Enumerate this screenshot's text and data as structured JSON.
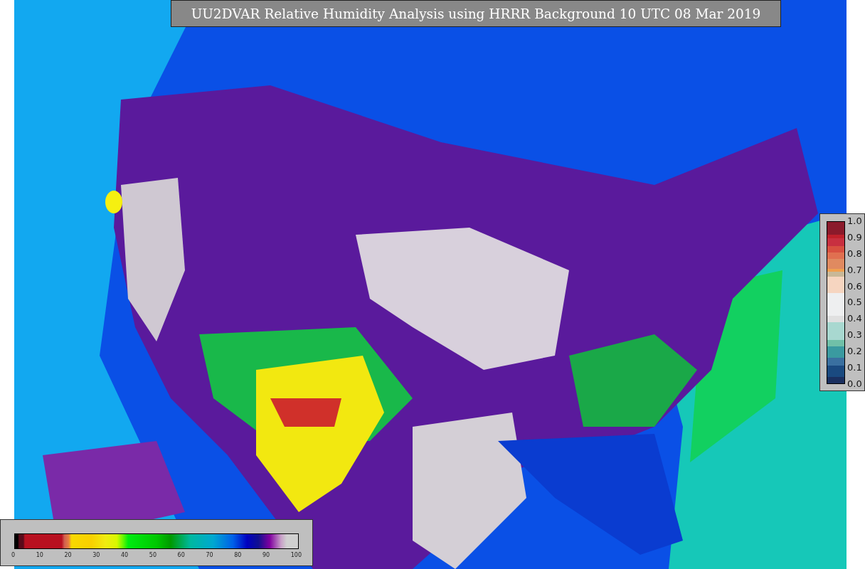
{
  "title": "UU2DVAR Relative Humidity Analysis using HRRR Background 10 UTC 08 Mar 2019",
  "humidity_colorbar": {
    "ticks": [
      "0",
      "10",
      "20",
      "30",
      "40",
      "50",
      "60",
      "70",
      "80",
      "90",
      "100"
    ]
  },
  "observation_colorbar": {
    "ticks": [
      "1.0",
      "0.9",
      "0.8",
      "0.7",
      "0.6",
      "0.5",
      "0.4",
      "0.3",
      "0.2",
      "0.1",
      "0.0"
    ]
  }
}
